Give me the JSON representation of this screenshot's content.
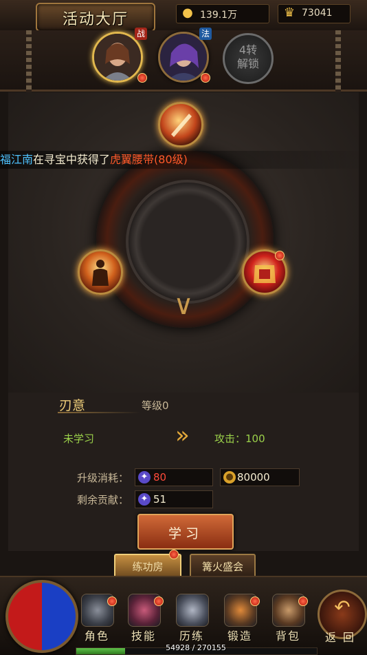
{
  "header": {
    "title": "活动大厅",
    "gold": "139.1万",
    "ingot": "73041"
  },
  "heroes": [
    {
      "badge": "战",
      "selected": true
    },
    {
      "badge": "法",
      "selected": false
    }
  ],
  "locked_slot": {
    "line1": "4转",
    "line2": "解锁"
  },
  "broadcast": {
    "player": "福江南",
    "text": "在寻宝中获得了",
    "item": "虎翼腰带(80级)"
  },
  "skill_info": {
    "name": "刃意",
    "level": "等级0",
    "status": "未学习",
    "next": "攻击：100"
  },
  "cost": {
    "upgrade_label": "升级消耗：",
    "contrib_cost": "80",
    "gold_cost": "80000",
    "remain_label": "剩余贡献：",
    "remain_value": "51"
  },
  "learn_button": "学习",
  "tabs": [
    {
      "label": "练功房",
      "active": true
    },
    {
      "label": "篝火盛会",
      "active": false
    }
  ],
  "nav": [
    {
      "label": "角色",
      "icon": "armor-icon"
    },
    {
      "label": "技能",
      "icon": "skill-icon"
    },
    {
      "label": "历练",
      "icon": "helmet-icon"
    },
    {
      "label": "锻造",
      "icon": "anvil-icon"
    },
    {
      "label": "背包",
      "icon": "bag-icon"
    }
  ],
  "back_label": "返回",
  "exp": {
    "text": "54928 / 270155",
    "fraction": 0.203
  },
  "colors": {
    "accent": "#f0cf7a",
    "green": "#9bd14a",
    "red": "#ff4a3a",
    "player": "#4fc3ff",
    "item": "#ff5a2a"
  }
}
